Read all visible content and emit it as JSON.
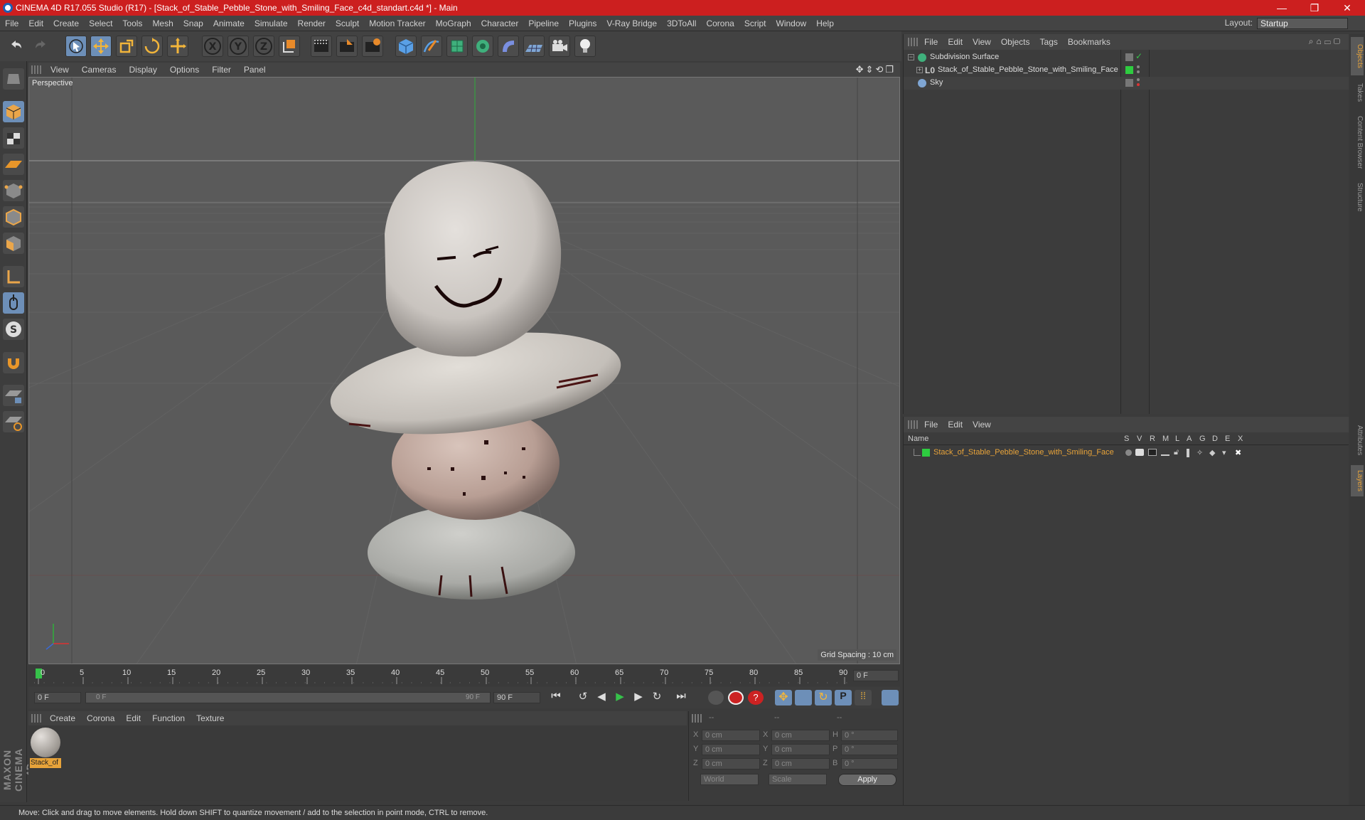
{
  "titlebar": {
    "title": "CINEMA 4D R17.055 Studio (R17) - [Stack_of_Stable_Pebble_Stone_with_Smiling_Face_c4d_standart.c4d *] - Main",
    "minimize": "—",
    "maximize": "❐",
    "close": "✕"
  },
  "menubar": {
    "items": [
      "File",
      "Edit",
      "Create",
      "Select",
      "Tools",
      "Mesh",
      "Snap",
      "Animate",
      "Simulate",
      "Render",
      "Sculpt",
      "Motion Tracker",
      "MoGraph",
      "Character",
      "Pipeline",
      "Plugins",
      "V-Ray Bridge",
      "3DToAll",
      "Corona",
      "Script",
      "Window",
      "Help"
    ],
    "layout_label": "Layout:",
    "layout_value": "Startup"
  },
  "viewport": {
    "menu": [
      "View",
      "Cameras",
      "Display",
      "Options",
      "Filter",
      "Panel"
    ],
    "label": "Perspective",
    "grid_spacing": "Grid Spacing : 10 cm"
  },
  "timeline": {
    "ticks": [
      "0",
      "5",
      "10",
      "15",
      "20",
      "25",
      "30",
      "35",
      "40",
      "45",
      "50",
      "55",
      "60",
      "65",
      "70",
      "75",
      "80",
      "85",
      "90"
    ],
    "current_frame": "0 F",
    "start_field": "0 F",
    "range_start": "0 F",
    "range_end": "90 F",
    "end_field": "90 F"
  },
  "material_manager": {
    "menu": [
      "Create",
      "Corona",
      "Edit",
      "Function",
      "Texture"
    ],
    "material_label": "Stack_of"
  },
  "coordinates": {
    "header": [
      "--",
      "--",
      "--"
    ],
    "rows": [
      {
        "axis1": "X",
        "val1": "0 cm",
        "axis2": "X",
        "val2": "0 cm",
        "axis3": "H",
        "val3": "0 °"
      },
      {
        "axis1": "Y",
        "val1": "0 cm",
        "axis2": "Y",
        "val2": "0 cm",
        "axis3": "P",
        "val3": "0 °"
      },
      {
        "axis1": "Z",
        "val1": "0 cm",
        "axis2": "Z",
        "val2": "0 cm",
        "axis3": "B",
        "val3": "0 °"
      }
    ],
    "mode1": "World",
    "mode2": "Scale",
    "apply": "Apply"
  },
  "object_manager": {
    "menu": [
      "File",
      "Edit",
      "View",
      "Objects",
      "Tags",
      "Bookmarks"
    ],
    "objects": [
      {
        "name": "Subdivision Surface"
      },
      {
        "name": "Stack_of_Stable_Pebble_Stone_with_Smiling_Face"
      },
      {
        "name": "Sky"
      }
    ]
  },
  "layer_manager": {
    "menu": [
      "File",
      "Edit",
      "View"
    ],
    "columns": [
      "Name",
      "S",
      "V",
      "R",
      "M",
      "L",
      "A",
      "G",
      "D",
      "E",
      "X"
    ],
    "layers": [
      {
        "name": "Stack_of_Stable_Pebble_Stone_with_Smiling_Face"
      }
    ]
  },
  "right_tabs": [
    "Objects",
    "Takes",
    "Content Browser",
    "Structure",
    "Attributes",
    "Layers"
  ],
  "brand": "MAXON CINEMA 4D",
  "status": "Move: Click and drag to move elements. Hold down SHIFT to quantize movement / add to the selection in point mode, CTRL to remove.",
  "colors": {
    "title_red": "#cc1f1f",
    "accent_blue": "#6d8fb8",
    "layer_green": "#2ecc40",
    "layer_name": "#e7a33a"
  }
}
